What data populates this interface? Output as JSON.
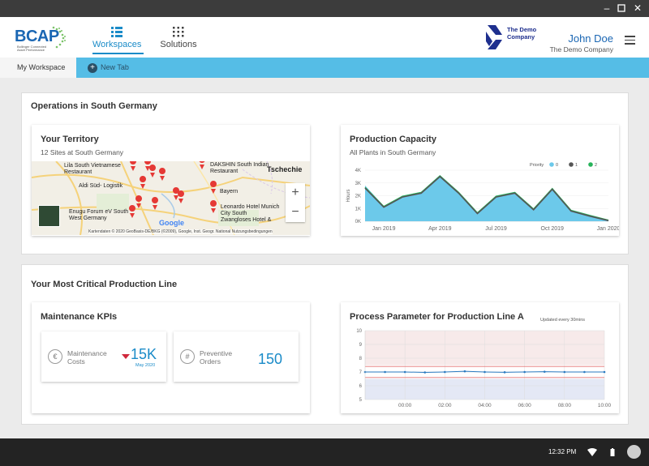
{
  "header": {
    "logo_text": "BCAP",
    "logo_subtitle": "Bollinger Connected Asset Performance",
    "nav": [
      {
        "label": "Workspaces",
        "active": true,
        "icon": "workspaces-icon"
      },
      {
        "label": "Solutions",
        "active": false,
        "icon": "grid-icon"
      }
    ],
    "company_logo_text": "The Demo Company",
    "user_name": "John Doe",
    "user_company": "The Demo Company"
  },
  "tabs": {
    "active_label": "My Workspace",
    "new_tab_label": "New Tab"
  },
  "section1": {
    "title": "Operations in South Germany",
    "territory": {
      "title": "Your Territory",
      "subtitle": "12 Sites at South Germany",
      "map_labels": [
        "Lila South Vietnamese Restaurant",
        "DAKSHIN South Indian Restaurant",
        "Tschechie",
        "Aldi Süd- Logistik",
        "Bayern",
        "Leonardo Hotel Munich City South",
        "Zwangloses Hotel &",
        "Enugu Forum eV South West Germany"
      ],
      "zoom_in": "+",
      "zoom_out": "−",
      "google": "Google",
      "credit": "Kartendaten © 2020 GeoBasis-DE/BKG (©2009), Google, Inst. Geogr. National   Nutzungsbedingungen"
    },
    "capacity": {
      "title": "Production Capacity",
      "subtitle": "All Plants in South Germany"
    }
  },
  "section2": {
    "title": "Your Most Critical Production Line",
    "maintenance": {
      "title": "Maintenance KPIs",
      "kpis": [
        {
          "icon_glyph": "€",
          "label": "Maintenance Costs",
          "value": "15K",
          "date": "May 2020",
          "trend": "down"
        },
        {
          "icon_glyph": "#",
          "label": "Preventive Orders",
          "value": "150",
          "date": "",
          "trend": ""
        }
      ]
    },
    "process": {
      "title": "Process Parameter for Production Line A",
      "note": "Updated  every 30mins"
    }
  },
  "chart_data": [
    {
      "type": "area",
      "ylabel": "Hours",
      "legend_title": "Priority",
      "legend_placement": "top-right",
      "yticks": [
        "0K",
        "1K",
        "2K",
        "3K",
        "4K"
      ],
      "ylim": [
        0,
        4000
      ],
      "x_tick_labels": [
        "Jan 2019",
        "Apr 2019",
        "Jul 2019",
        "Oct 2019",
        "Jan 2020"
      ],
      "x": [
        "Dec 2018",
        "Jan 2019",
        "Feb 2019",
        "Mar 2019",
        "Apr 2019",
        "May 2019",
        "Jun 2019",
        "Jul 2019",
        "Aug 2019",
        "Sep 2019",
        "Oct 2019",
        "Nov 2019",
        "Dec 2019",
        "Jan 2020"
      ],
      "series": [
        {
          "name": "0",
          "color": "#6cc9ea",
          "values": [
            2800,
            1200,
            2000,
            2300,
            3600,
            2300,
            700,
            2000,
            2300,
            1000,
            2600,
            900,
            500,
            100
          ]
        },
        {
          "name": "1",
          "color": "#555555",
          "values": [
            2600,
            1100,
            1900,
            2200,
            3500,
            2200,
            600,
            1900,
            2200,
            900,
            2500,
            800,
            400,
            50
          ]
        },
        {
          "name": "2",
          "color": "#27b35a",
          "values": [
            2650,
            1150,
            1950,
            2250,
            3550,
            2250,
            650,
            1950,
            2250,
            950,
            2550,
            850,
            450,
            75
          ]
        }
      ]
    },
    {
      "type": "line",
      "yticks": [
        "5",
        "6",
        "7",
        "8",
        "9",
        "10"
      ],
      "ylim": [
        5,
        10
      ],
      "x_tick_labels": [
        "00:00",
        "02:00",
        "04:00",
        "06:00",
        "08:00",
        "10:00"
      ],
      "xlim": [
        0,
        10
      ],
      "grid": true,
      "bands": {
        "upper_limit": 7.4,
        "lower_limit": 6.6,
        "shade_below": 6.5,
        "shade_above": 7.5
      },
      "series": [
        {
          "name": "",
          "color": "#2a7ac0",
          "x": [
            -2,
            -1,
            0,
            1,
            2,
            3,
            4,
            5,
            6,
            7,
            8,
            9,
            10
          ],
          "values": [
            7.0,
            7.0,
            7.0,
            6.97,
            7.0,
            7.05,
            7.0,
            6.98,
            7.0,
            7.02,
            7.0,
            7.0,
            7.0
          ]
        }
      ]
    }
  ],
  "taskbar": {
    "clock": "12:32 PM"
  }
}
